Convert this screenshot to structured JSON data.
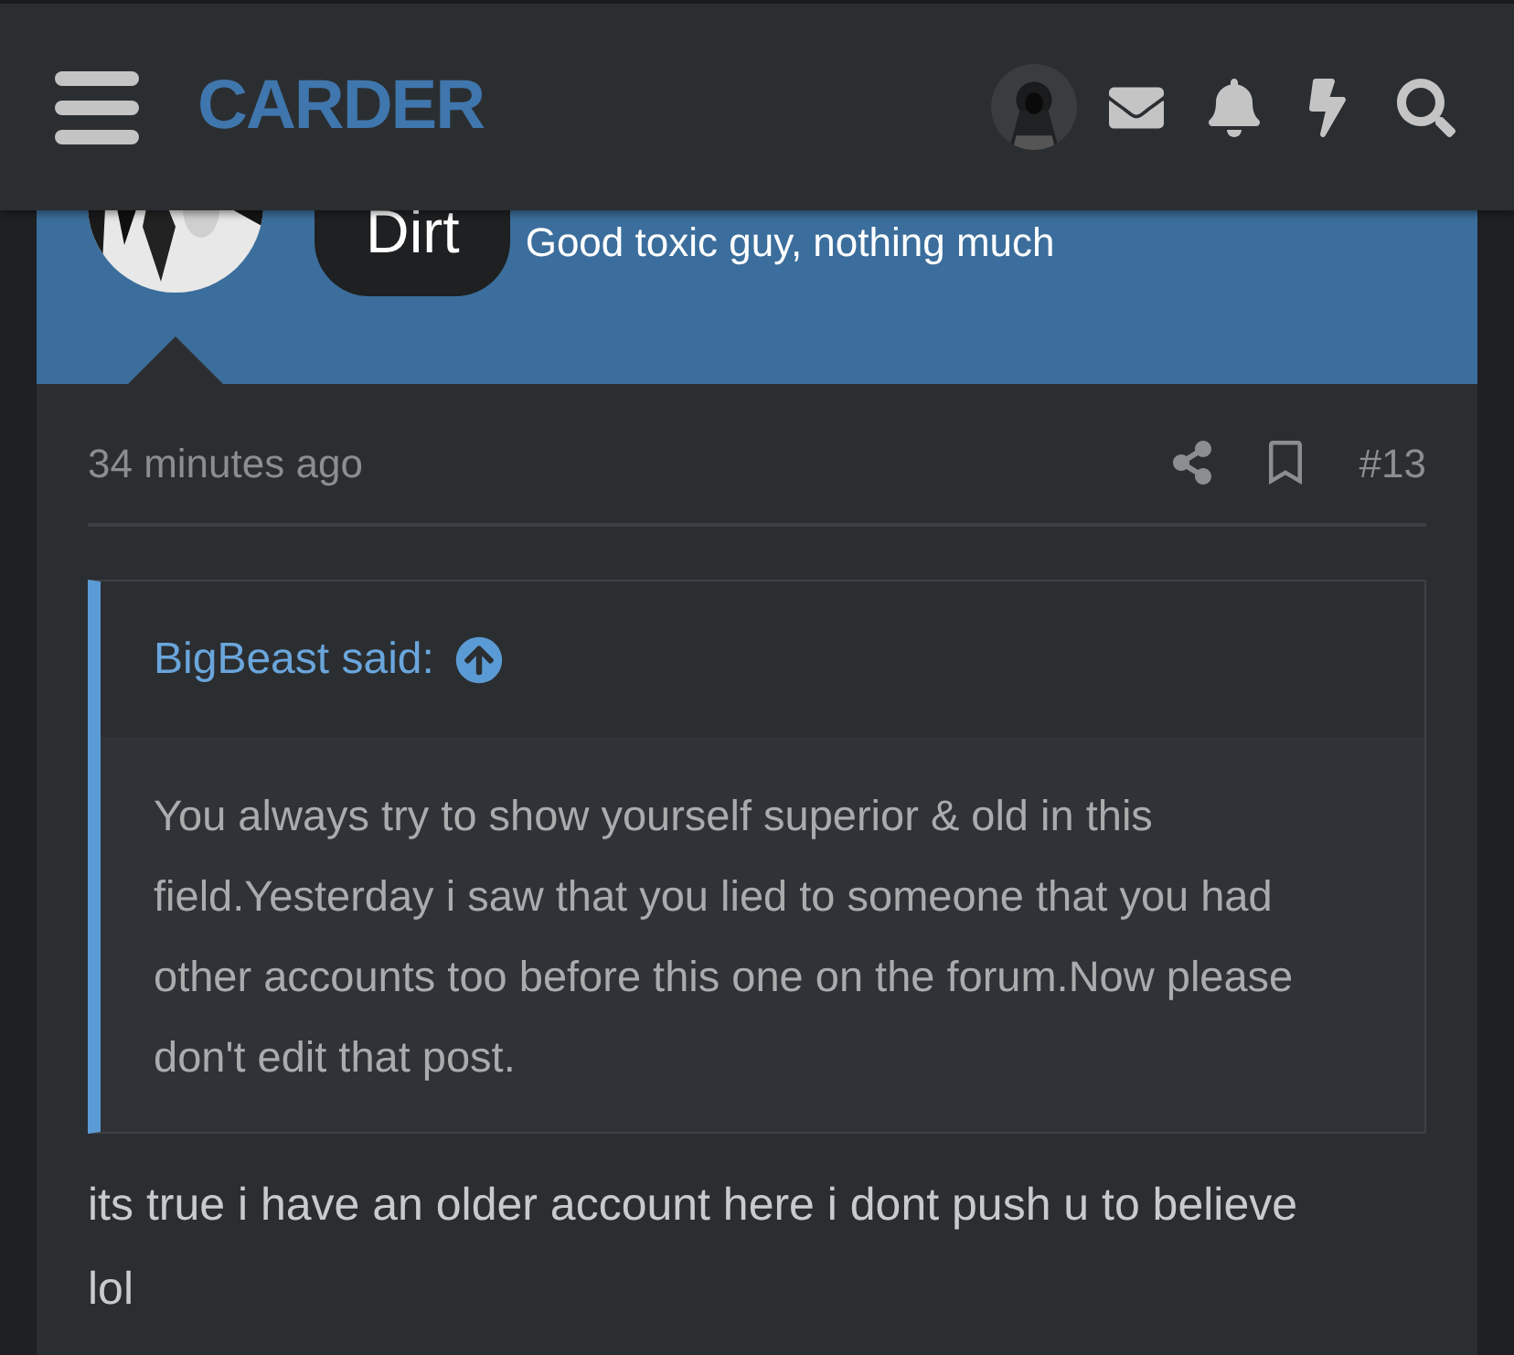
{
  "header": {
    "logo": "CARDER"
  },
  "author": {
    "name": "Dirt",
    "user_title": "Good toxic guy, nothing much"
  },
  "post": {
    "time": "34 minutes ago",
    "number": "#13",
    "quote": {
      "attribution": "BigBeast said:",
      "text": "You always try to show yourself superior & old in this field.Yesterday i saw that you lied to someone that you had other accounts too before this one on the forum.Now please don't edit that post."
    },
    "body": "its true i have an older account here i dont push u to believe lol"
  }
}
